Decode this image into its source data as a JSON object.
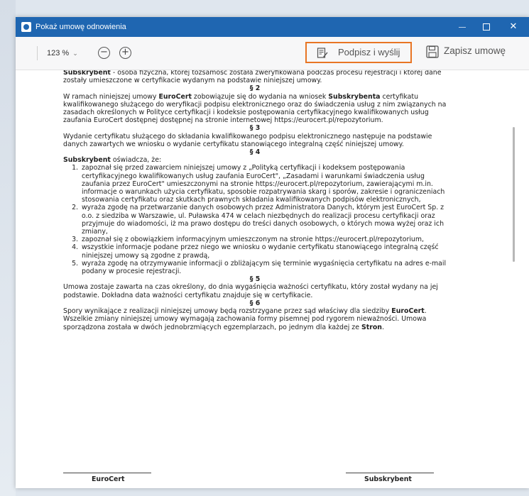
{
  "window": {
    "title": "Pokaż umowę odnowienia",
    "minimize": "—",
    "maximize": "",
    "close": "✕"
  },
  "toolbar": {
    "zoom_value": "123 %",
    "zoom_chevron": "⌄",
    "zoom_out": "−",
    "zoom_in": "+",
    "sign_label": "Podpisz i wyślij",
    "save_label": "Zapisz umowę"
  },
  "accent_colors": {
    "titlebar": "#1f66b1",
    "sign_highlight": "#e87524"
  },
  "icons": [
    "app-icon",
    "zoom-out-icon",
    "zoom-in-icon",
    "sign-document-icon",
    "save-floppy-icon"
  ],
  "doc": {
    "intro_bold": "Subskrybent",
    "intro_text": " - osoba fizyczna, której tożsamość została zweryfikowana podczas procesu rejestracji i której dane zostały umieszczone w certyfikacie wydanym na podstawie niniejszej umowy.",
    "s2_head": "§ 2",
    "s2_a": "W ramach niniejszej umowy ",
    "s2_b": "EuroCert",
    "s2_c": " zobowiązuje się do wydania na wniosek ",
    "s2_d": "Subskrybenta",
    "s2_e": " certyfikatu kwalifikowanego służącego do weryfikacji podpisu elektronicznego oraz do świadczenia usług  z nim związanych na zasadach określonych w Polityce certyfikacji i kodeksie postępowania certyfikacyjnego kwalifikowanych usług zaufania EuroCert dostępnej dostępnej na stronie internetowej https://eurocert.pl/repozytorium.",
    "s3_head": "§ 3",
    "s3_text": "Wydanie certyfikatu służącego do składania kwalifikowanego podpisu elektronicznego następuje na podstawie danych zawartych we wniosku o wydanie certyfikatu stanowiącego integralną część niniejszej umowy.",
    "s4_head": "§ 4",
    "s4_bold": "Subskrybent",
    "s4_text": " oświadcza, że:",
    "s4_items": [
      "zapoznał się przed zawarciem niniejszej umowy z „Polityką certyfikacji i kodeksem postępowania certyfikacyjnego kwalifikowanych usług zaufania EuroCert\", „Zasadami i warunkami świadczenia usług zaufania przez EuroCert\" umieszczonymi na stronie https://eurocert.pl/repozytorium, zawierającymi m.in. informacje o warunkach użycia certyfikatu, sposobie rozpatrywania skarg i sporów, zakresie i ograniczeniach stosowania certyfikatu oraz skutkach prawnych składania kwalifikowanych podpisów elektronicznych,",
      "wyraża zgodę na przetwarzanie danych osobowych przez Administratora Danych, którym jest EuroCert Sp. z o.o. z siedziba w Warszawie, ul. Puławska 474 w celach niezbędnych do realizacji procesu certyfikacji oraz przyjmuje do wiadomości, iż ma prawo dostępu do treści danych osobowych, o których mowa wyżej oraz ich zmiany,",
      "zapoznał się z obowiązkiem informacyjnym umieszczonym na stronie https://eurocert.pl/repozytorium,",
      "wszystkie informacje podane przez niego we wniosku o wydanie certyfikatu stanowiącego integralną część niniejszej umowy są zgodne z prawdą,",
      "wyraża zgodę na otrzymywanie informacji o zbliżającym się terminie wygaśnięcia certyfikatu na adres e-mail podany w procesie rejestracji."
    ],
    "s5_head": "§ 5",
    "s5_text": "Umowa zostaje zawarta na czas określony, do dnia wygaśnięcia ważności certyfikatu, który został wydany na jej podstawie. Dokładna data ważności certyfikatu znajduje się w certyfikacie.",
    "s6_head": "§ 6",
    "s6_a": "Spory wynikające z realizacji niniejszej umowy będą rozstrzygane przez sąd właściwy dla siedziby ",
    "s6_b": "EuroCert",
    "s6_c": ". Wszelkie zmiany niniejszej umowy wymagają zachowania formy pisemnej pod rygorem nieważności. Umowa sporządzona została w dwóch jednobrzmiących egzemplarzach, po jednym dla każdej ze ",
    "s6_d": "Stron",
    "s6_e": ".",
    "sig_left": "EuroCert",
    "sig_right": "Subskrybent"
  }
}
